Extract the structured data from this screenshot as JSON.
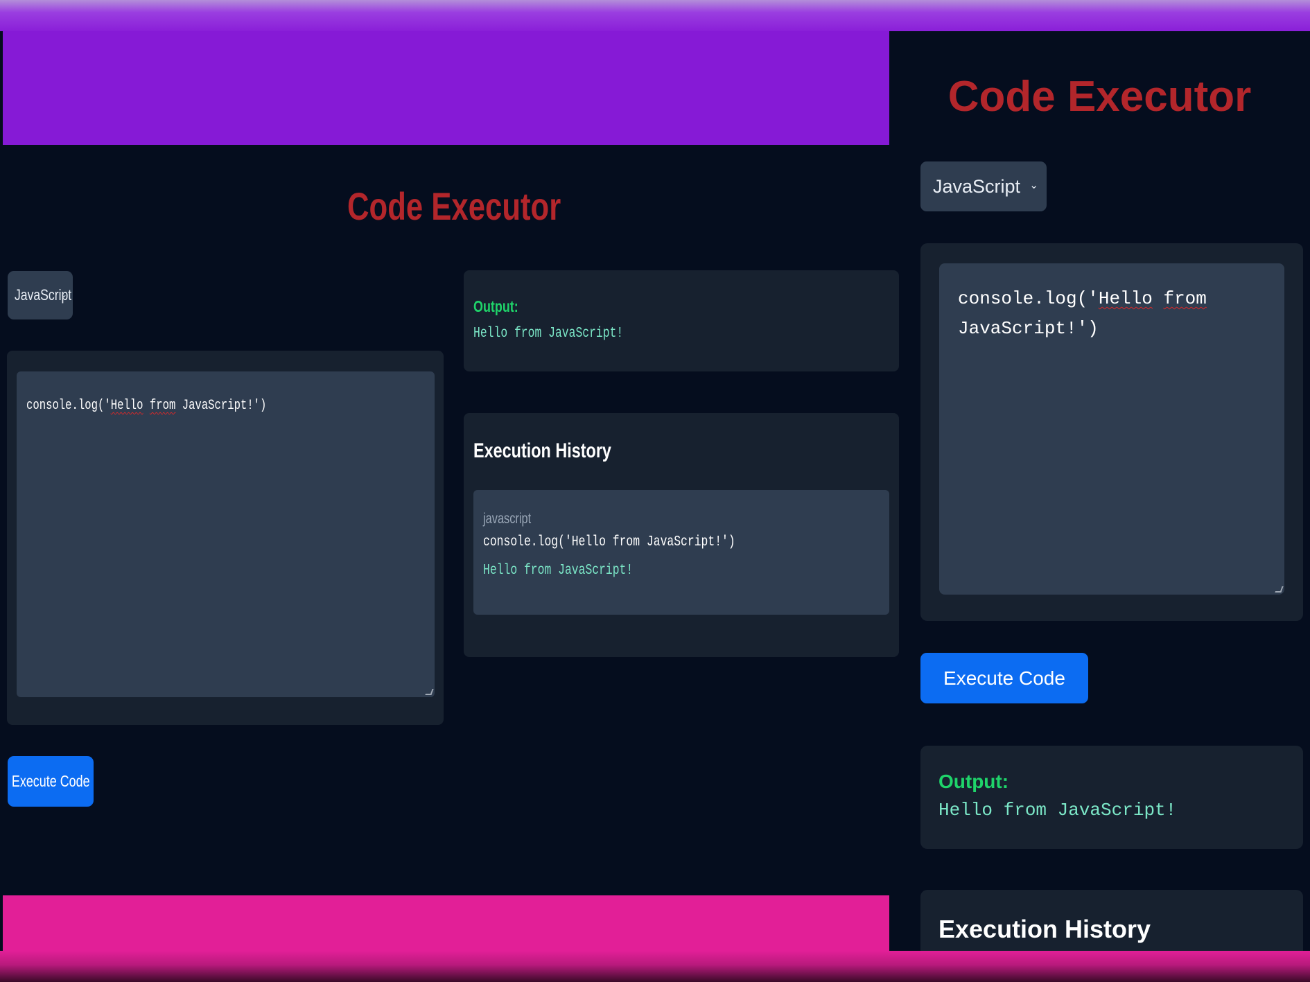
{
  "app": {
    "title": "Code Executor",
    "language": "JavaScript",
    "code_line1_prefix": "console.log('",
    "code_word_hello": "Hello",
    "code_space": " ",
    "code_word_from": "from",
    "code_suffix": " JavaScript!')",
    "code_line2": "JavaScript!')",
    "execute_label": "Execute Code",
    "output_label": "Output:",
    "output_value": "Hello from JavaScript!",
    "history_heading": "Execution History",
    "history": [
      {
        "language": "javascript",
        "code": "console.log('Hello from JavaScript!')",
        "output": "Hello from JavaScript!"
      }
    ]
  },
  "colors": {
    "background": "#050d1e",
    "title": "#b3262b",
    "card": "#17212f",
    "field": "#2f3d50",
    "button": "#0c6cf2",
    "output_label": "#1fd46a",
    "output_text": "#7ce8c8",
    "purple_band": "#861ad6",
    "pink_band": "#e21f97"
  }
}
